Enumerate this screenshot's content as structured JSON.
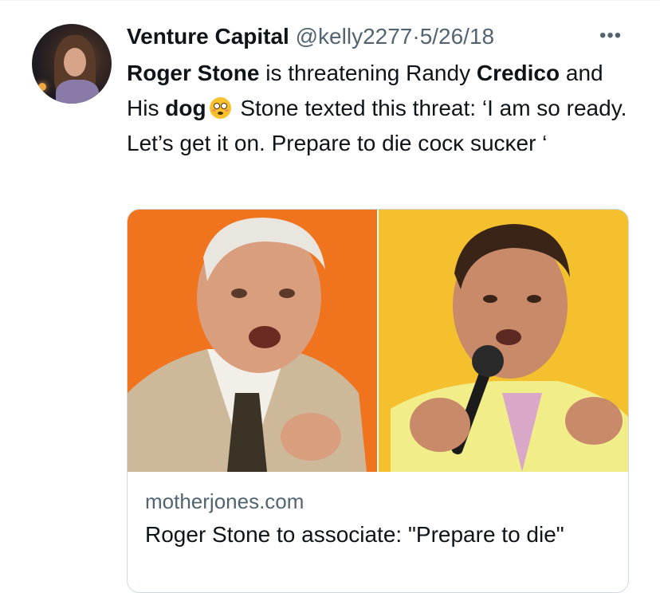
{
  "tweet": {
    "author_name": "Venture Capital",
    "handle": "@kelly2277",
    "separator": "·",
    "date": "5/26/18",
    "more_icon": "more-horizontal-icon",
    "text_segments": {
      "s1": "Roger Stone",
      "s2": " is threatening Randy ",
      "s3": "Credico",
      "s4": " and His ",
      "s5": "dog",
      "emoji": "flushed-face-emoji",
      "s6": " Stone texted this threat: ‘I am so ready. Let’s get it on. Prepare to die сосĸ suсĸеr ‘"
    }
  },
  "link_card": {
    "image_description_icon": "card-image",
    "domain": "motherjones.com",
    "title": "Roger Stone to associate: \"Prepare to die\"",
    "colors": {
      "left_bg": "#f0731e",
      "right_bg": "#f3b81f"
    }
  }
}
